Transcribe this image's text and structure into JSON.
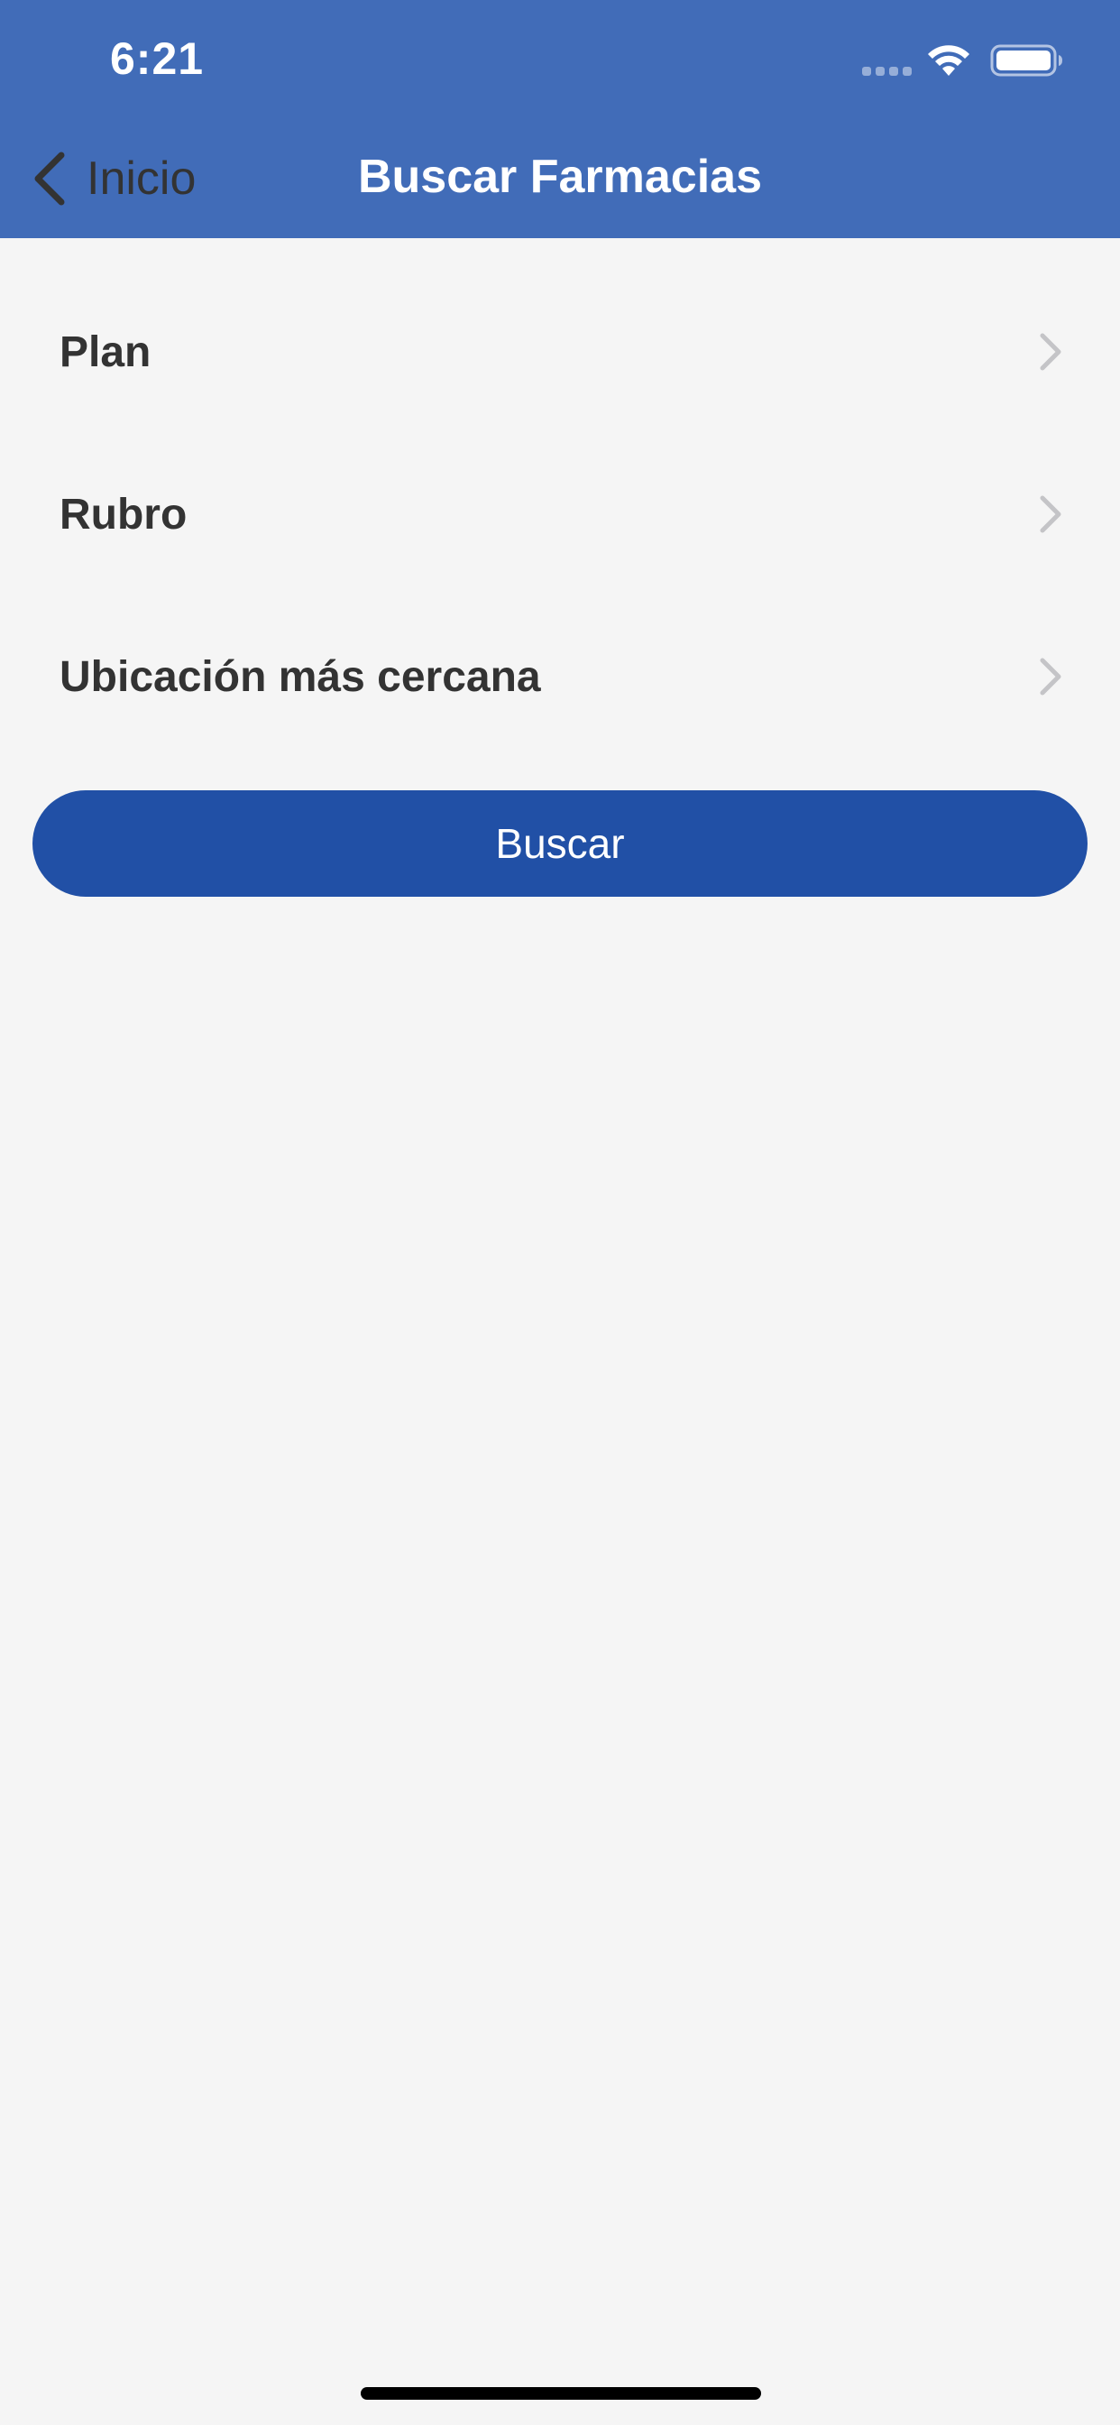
{
  "status_bar": {
    "time": "6:21",
    "icons": [
      "signal-dots-icon",
      "wifi-icon",
      "battery-icon"
    ]
  },
  "nav": {
    "back_label": "Inicio",
    "title": "Buscar Farmacias",
    "back_icon": "chevron-left-icon"
  },
  "list": {
    "items": [
      {
        "label": "Plan",
        "icon": "chevron-right-icon"
      },
      {
        "label": "Rubro",
        "icon": "chevron-right-icon"
      },
      {
        "label": "Ubicación más cercana",
        "icon": "chevron-right-icon"
      }
    ]
  },
  "search_button": {
    "label": "Buscar"
  },
  "colors": {
    "header": "#416cb8",
    "button": "#2150a6",
    "background": "#f5f5f5",
    "text": "#333333",
    "chevron": "#c4c4c7"
  }
}
